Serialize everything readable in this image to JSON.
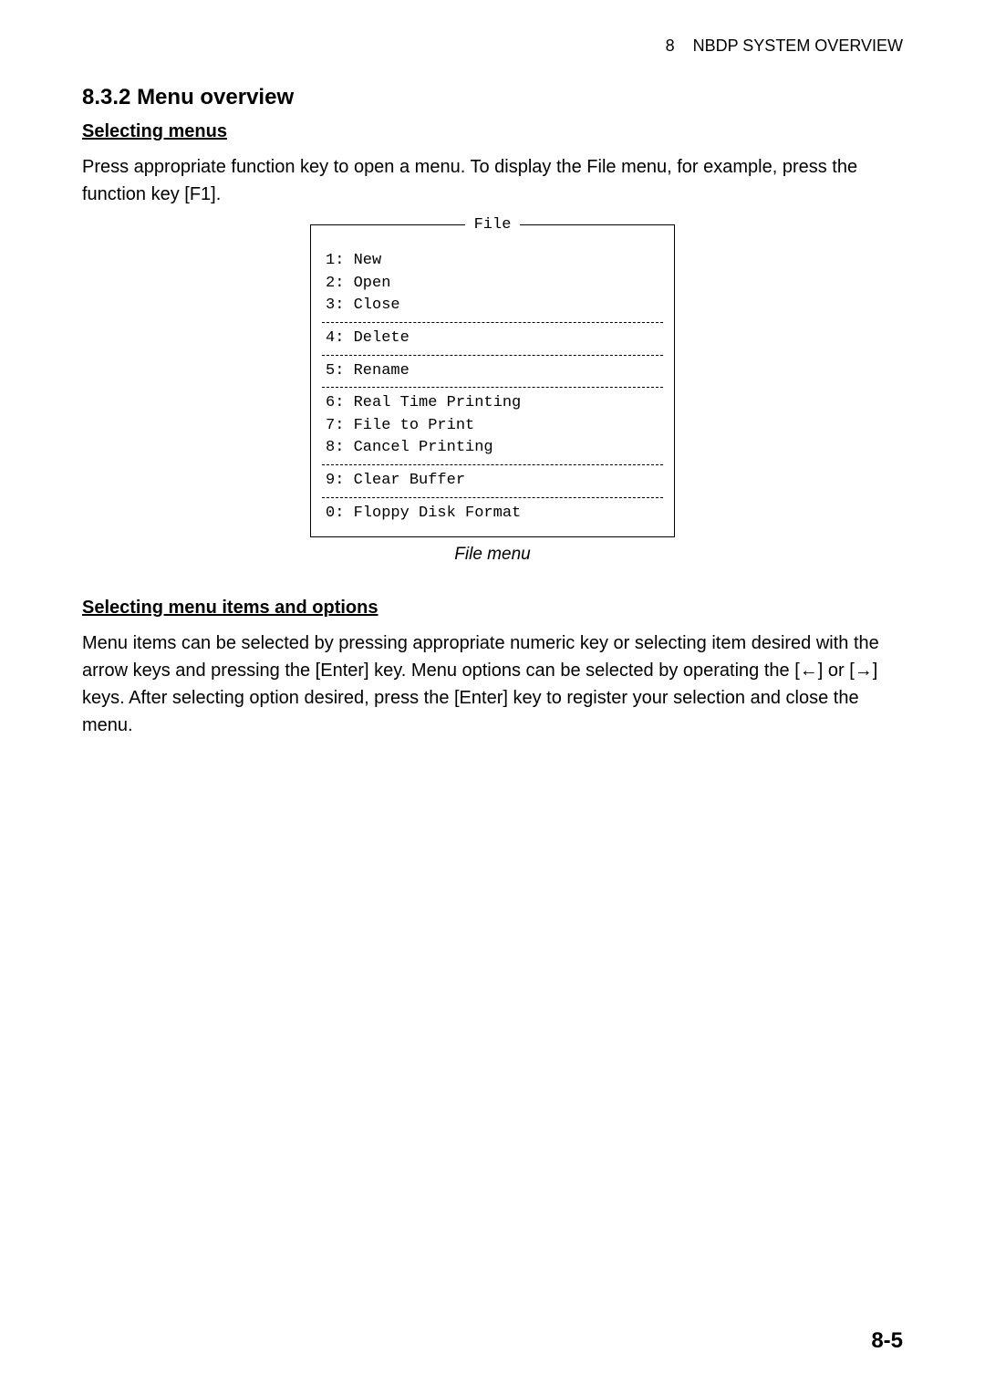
{
  "header": {
    "chapter_number": "8",
    "chapter_title": "NBDP SYSTEM OVERVIEW"
  },
  "section": {
    "number": "8.3.2",
    "title": "Menu overview"
  },
  "selecting_menus": {
    "heading": "Selecting menus",
    "paragraph": "Press appropriate function key to open a menu. To display the File menu, for example, press the function key [F1]."
  },
  "file_menu": {
    "title": "File",
    "group1": {
      "item1": "1: New",
      "item2": "2: Open",
      "item3": "3: Close"
    },
    "group2": {
      "item4": "4: Delete"
    },
    "group3": {
      "item5": "5: Rename"
    },
    "group4": {
      "item6": "6: Real Time Printing",
      "item7": "7: File to Print",
      "item8": "8: Cancel Printing"
    },
    "group5": {
      "item9": "9: Clear Buffer"
    },
    "group6": {
      "item0": "0: Floppy Disk Format"
    },
    "caption": "File menu"
  },
  "selecting_items": {
    "heading": "Selecting menu items and options",
    "paragraph": "Menu items can be selected by pressing appropriate numeric key or selecting item desired with the arrow keys and pressing the [Enter] key. Menu options can be selected by operating the [←] or [→] keys. After selecting option desired, press the [Enter] key to register your selection and close the menu."
  },
  "footer": {
    "page_number": "8-5"
  }
}
